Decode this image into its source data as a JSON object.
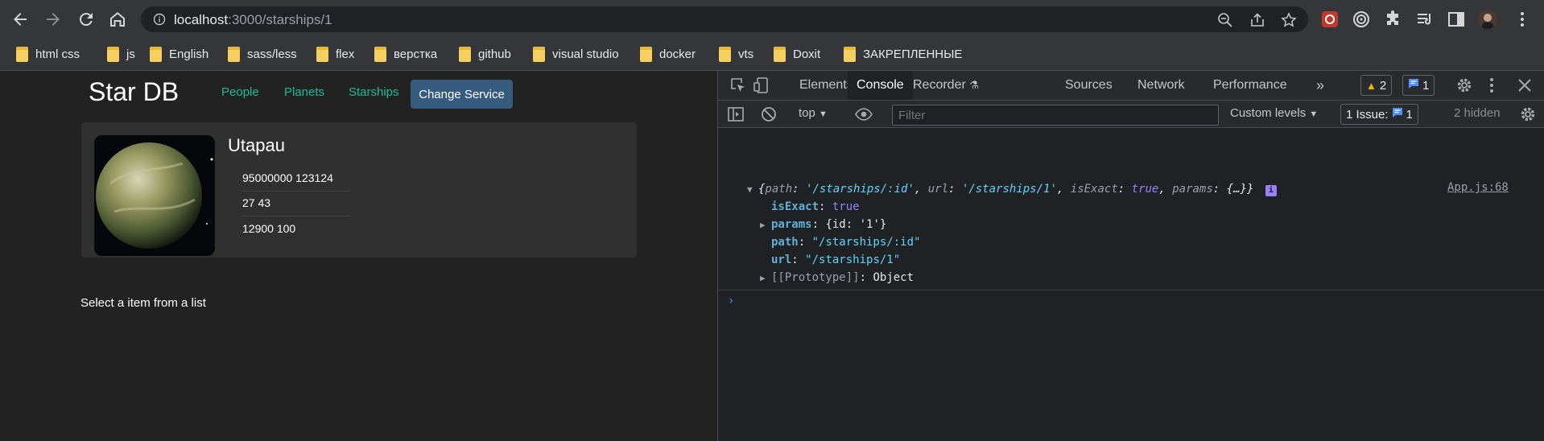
{
  "browser": {
    "url_host": "localhost",
    "url_path": ":3000/starships/1"
  },
  "bookmarks": [
    {
      "label": "html css"
    },
    {
      "label": "js"
    },
    {
      "label": "English"
    },
    {
      "label": "sass/less"
    },
    {
      "label": "flex"
    },
    {
      "label": "верстка"
    },
    {
      "label": "github"
    },
    {
      "label": "visual studio"
    },
    {
      "label": "docker"
    },
    {
      "label": "vts"
    },
    {
      "label": "Doxit"
    },
    {
      "label": "ЗАКРЕПЛЕННЫЕ"
    }
  ],
  "app": {
    "brand": "Star DB",
    "nav": {
      "people": "People",
      "planets": "Planets",
      "starships": "Starships"
    },
    "change_service": "Change Service",
    "planet": {
      "name": "Utapau",
      "rows": [
        "95000000  123124",
        "27  43",
        "12900  100"
      ]
    },
    "select_message": "Select a item from a list"
  },
  "devtools": {
    "tabs": {
      "elements": "Elements",
      "console": "Console",
      "recorder": "Recorder",
      "sources": "Sources",
      "network": "Network",
      "performance": "Performance"
    },
    "warnings_count": "2",
    "messages_count": "1",
    "context": "top",
    "filter_placeholder": "Filter",
    "custom_levels": "Custom levels",
    "issues_label": "1 Issue:",
    "issues_count": "1",
    "hidden": "2 hidden",
    "log": {
      "source": "App.js:68",
      "summary": {
        "path_key": "path",
        "path_val": "'/starships/:id'",
        "url_key": "url",
        "url_val": "'/starships/1'",
        "isExact_key": "isExact",
        "isExact_val": "true",
        "params_key": "params",
        "params_val": "{…}"
      },
      "props": [
        {
          "key": "isExact",
          "value": "true",
          "kind": "kw"
        },
        {
          "key": "params",
          "value": "{id: '1'}",
          "kind": "obj"
        },
        {
          "key": "path",
          "value": "\"/starships/:id\"",
          "kind": "str"
        },
        {
          "key": "url",
          "value": "\"/starships/1\"",
          "kind": "str"
        },
        {
          "key": "[[Prototype]]",
          "value": "Object",
          "kind": "obj"
        }
      ]
    }
  },
  "colors": {
    "accent": "#18bc9c",
    "button": "#375a7f",
    "string": "#5cd5fb",
    "keyword": "#9980ff"
  }
}
